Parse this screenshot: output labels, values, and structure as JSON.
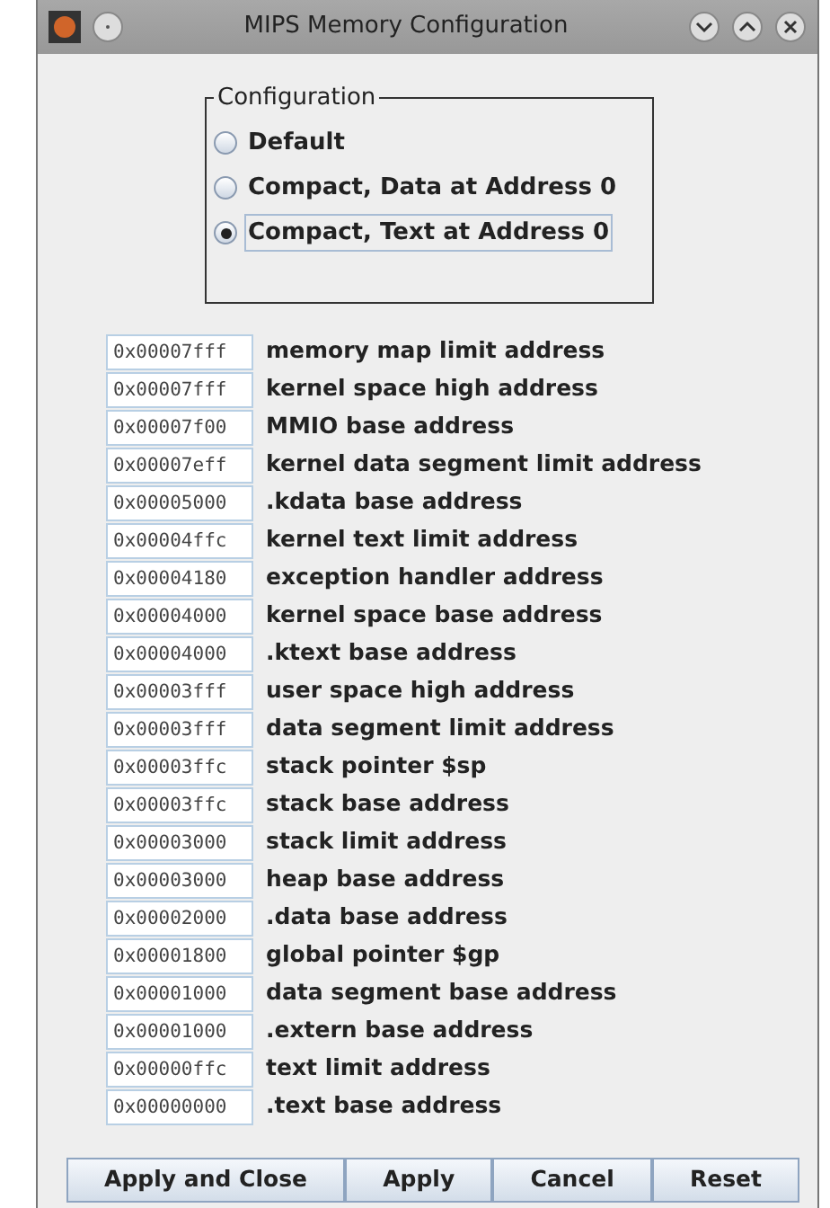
{
  "window": {
    "title": "MIPS Memory Configuration"
  },
  "configuration": {
    "title": "Configuration",
    "options": [
      {
        "label": "Default",
        "selected": false
      },
      {
        "label": "Compact, Data at Address 0",
        "selected": false
      },
      {
        "label": "Compact, Text at Address 0",
        "selected": true
      }
    ]
  },
  "addresses": [
    {
      "value": "0x00007fff",
      "label": "memory map limit address"
    },
    {
      "value": "0x00007fff",
      "label": "kernel space high address"
    },
    {
      "value": "0x00007f00",
      "label": "MMIO base address"
    },
    {
      "value": "0x00007eff",
      "label": "kernel data segment limit address"
    },
    {
      "value": "0x00005000",
      "label": ".kdata base address"
    },
    {
      "value": "0x00004ffc",
      "label": "kernel text limit address"
    },
    {
      "value": "0x00004180",
      "label": "exception handler address"
    },
    {
      "value": "0x00004000",
      "label": "kernel space base address"
    },
    {
      "value": "0x00004000",
      "label": ".ktext base address"
    },
    {
      "value": "0x00003fff",
      "label": "user space high address"
    },
    {
      "value": "0x00003fff",
      "label": "data segment limit address"
    },
    {
      "value": "0x00003ffc",
      "label": "stack pointer $sp"
    },
    {
      "value": "0x00003ffc",
      "label": "stack base address"
    },
    {
      "value": "0x00003000",
      "label": "stack limit address"
    },
    {
      "value": "0x00003000",
      "label": "heap base address"
    },
    {
      "value": "0x00002000",
      "label": ".data base address"
    },
    {
      "value": "0x00001800",
      "label": "global pointer $gp"
    },
    {
      "value": "0x00001000",
      "label": "data segment base address"
    },
    {
      "value": "0x00001000",
      "label": ".extern base address"
    },
    {
      "value": "0x00000ffc",
      "label": "text limit address"
    },
    {
      "value": "0x00000000",
      "label": ".text base address"
    }
  ],
  "buttons": [
    "Apply and Close",
    "Apply",
    "Cancel",
    "Reset"
  ]
}
